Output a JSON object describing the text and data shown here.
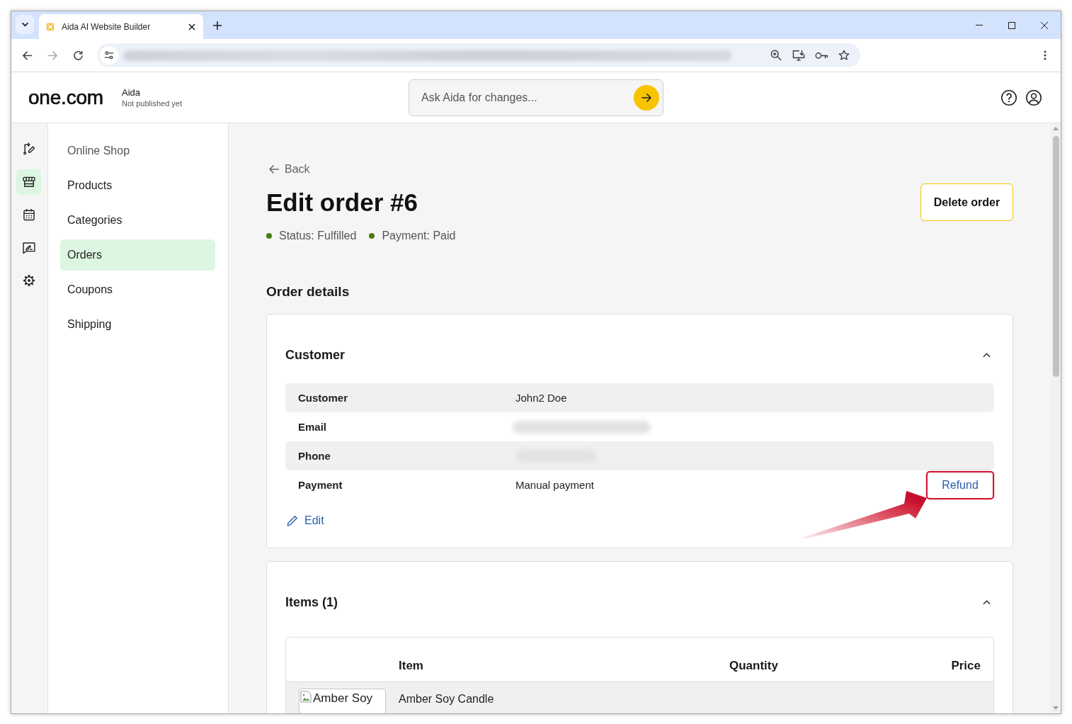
{
  "browser": {
    "tabs": [
      {
        "title": "Aida AI Website Builder",
        "selected": true
      }
    ],
    "nav_buttons": [
      {
        "kind": "back",
        "disabled": false
      },
      {
        "kind": "forward",
        "disabled": true
      },
      {
        "kind": "reload",
        "disabled": false
      }
    ]
  },
  "header": {
    "logo": "one.com",
    "site_name": "Aida",
    "site_status": "Not published yet",
    "ask_field": {
      "placeholder": "Ask Aida for changes..."
    }
  },
  "icon_rail": [
    {
      "kind": "path",
      "selected": false
    },
    {
      "kind": "shop",
      "selected": true
    },
    {
      "kind": "calendar",
      "selected": false
    },
    {
      "kind": "blog",
      "selected": false
    },
    {
      "kind": "settings",
      "selected": false
    }
  ],
  "sidebar": {
    "title": "Online Shop",
    "items": [
      {
        "label": "Products",
        "selected": false
      },
      {
        "label": "Categories",
        "selected": false
      },
      {
        "label": "Orders",
        "selected": true
      },
      {
        "label": "Coupons",
        "selected": false
      },
      {
        "label": "Shipping",
        "selected": false
      }
    ]
  },
  "page": {
    "back_link": "Back",
    "title": "Edit order #6",
    "delete_button": "Delete order",
    "statuses": [
      {
        "text": "Status: Fulfilled",
        "color": "#4b7d10"
      },
      {
        "text": "Payment: Paid",
        "color": "#4b7d10"
      }
    ],
    "section_title": "Order details"
  },
  "customer_card": {
    "title": "Customer",
    "expanded": true,
    "rows": [
      {
        "label": "Customer",
        "value": "John2 Doe",
        "redacted": false
      },
      {
        "label": "Email",
        "redacted": true
      },
      {
        "label": "Phone",
        "redacted": true
      },
      {
        "label": "Payment",
        "value": "Manual payment",
        "redacted": false,
        "action": {
          "label": "Refund",
          "highlighted": true
        }
      }
    ],
    "edit_link": "Edit"
  },
  "items_card": {
    "title": "Items (1)",
    "expanded": true,
    "table": {
      "columns": [
        "Item",
        "Quantity",
        "Price"
      ],
      "rows": [
        {
          "image_alt": "Amber Soy",
          "name": "Amber Soy Candle"
        }
      ]
    }
  }
}
